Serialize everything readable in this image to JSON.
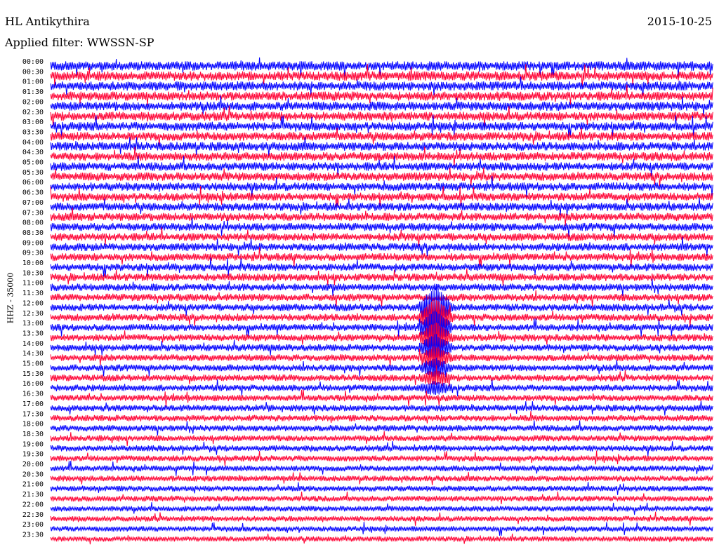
{
  "header": {
    "station": "HL Antikythira",
    "date": "2015-10-25",
    "filter": "Applied filter: WWSSN-SP"
  },
  "chart_data": {
    "type": "line",
    "title": "HL Antikythira",
    "ylabel": "HHZ - 35000",
    "colors": [
      "#0000ff",
      "#ff0033"
    ],
    "rows": [
      "00:00",
      "00:30",
      "01:00",
      "01:30",
      "02:00",
      "02:30",
      "03:00",
      "03:30",
      "04:00",
      "04:30",
      "05:00",
      "05:30",
      "06:00",
      "06:30",
      "07:00",
      "07:30",
      "08:00",
      "08:30",
      "09:00",
      "09:30",
      "10:00",
      "10:30",
      "11:00",
      "11:30",
      "12:00",
      "12:30",
      "13:00",
      "13:30",
      "14:00",
      "14:30",
      "15:00",
      "15:30",
      "16:00",
      "16:30",
      "17:00",
      "17:30",
      "18:00",
      "18:30",
      "19:00",
      "19:30",
      "20:00",
      "20:30",
      "21:00",
      "21:30",
      "22:00",
      "22:30",
      "23:00",
      "23:30"
    ],
    "tick_labels": [
      "00:00",
      "00:30",
      "01:00",
      "01:30",
      "02:00",
      "02:30",
      "03:00",
      "03:30",
      "04:00",
      "04:30",
      "05:00",
      "05:30",
      "06:00",
      "06:30",
      "07:00",
      "07:30",
      "08:00",
      "08:30",
      "09:00",
      "09:30",
      "10:00",
      "10:30",
      "11:00",
      "11:30",
      "12:00",
      "12:30",
      "13:00",
      "13:30",
      "14:00",
      "14:30",
      "15:00",
      "15:30",
      "16:00",
      "16:30",
      "17:00",
      "17:30",
      "18:00",
      "18:30",
      "19:00",
      "19:30",
      "20:00",
      "20:30",
      "21:00",
      "21:30",
      "22:00",
      "22:30",
      "23:00",
      "23:30"
    ],
    "events": [
      {
        "start_row": "12:00",
        "end_row": "15:30",
        "trace_fraction": 0.57,
        "label": ""
      }
    ]
  }
}
